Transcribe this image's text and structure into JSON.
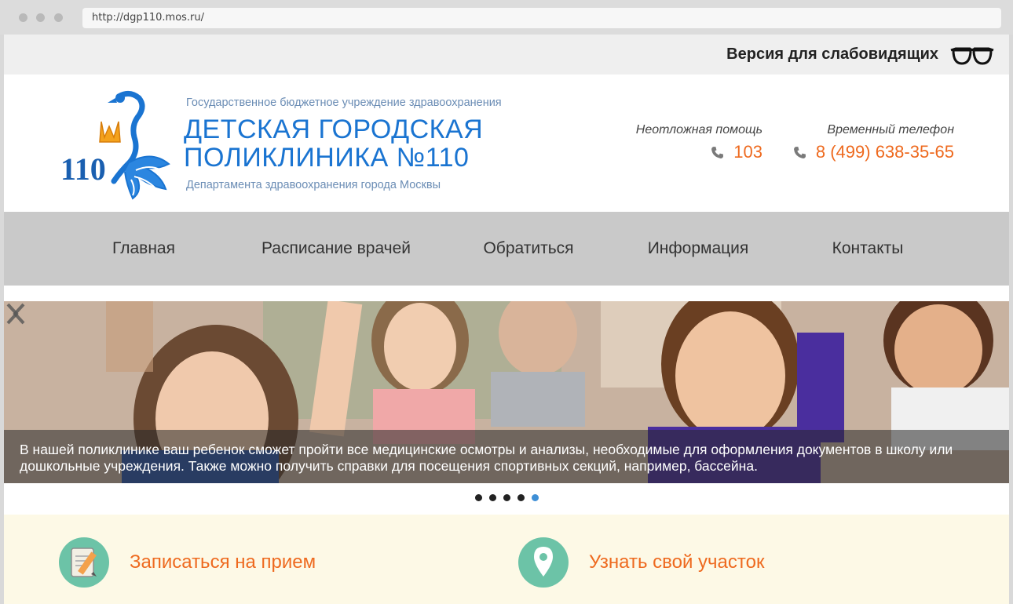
{
  "browser": {
    "url": "http://dgp110.mos.ru/"
  },
  "topbar": {
    "vision_label": "Версия для слабовидящих",
    "vision_icon": "glasses-icon"
  },
  "header": {
    "logo_number": "110",
    "org_sup": "Государственное бюджетное учреждение здравоохранения",
    "org_name_line1": "ДЕТСКАЯ ГОРОДСКАЯ",
    "org_name_line2": "ПОЛИКЛИНИКА №110",
    "org_sub": "Департамента здравоохранения города Москвы",
    "contacts": [
      {
        "label": "Неотложная помощь",
        "phone": "103"
      },
      {
        "label": "Временный телефон",
        "phone": "8 (499) 638-35-65"
      }
    ]
  },
  "nav": {
    "items": [
      {
        "label": "Главная"
      },
      {
        "label": "Расписание врачей"
      },
      {
        "label": "Обратиться"
      },
      {
        "label": "Информация"
      },
      {
        "label": "Контакты"
      }
    ]
  },
  "slider": {
    "caption": "В нашей поликлинике ваш ребенок сможет пройти все медицинские осмотры и анализы, необходимые для оформления документов в школу или дошкольные учреждения. Также можно получить справки для посещения спортивных секций, например, бассейна.",
    "slide_count": 5,
    "active_slide": 5
  },
  "actions": [
    {
      "label": "Записаться на прием",
      "icon": "notepad-pencil-icon"
    },
    {
      "label": "Узнать свой участок",
      "icon": "map-pin-icon"
    }
  ],
  "colors": {
    "brand_blue": "#1a74d1",
    "accent_orange": "#ee6a1f",
    "nav_bg": "#c9c9c9",
    "action_circle": "#6cc3a7"
  }
}
